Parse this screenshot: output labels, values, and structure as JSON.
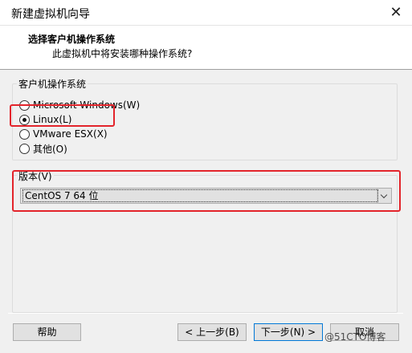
{
  "window": {
    "title": "新建虚拟机向导"
  },
  "header": {
    "title": "选择客户机操作系统",
    "subtitle": "此虚拟机中将安装哪种操作系统?"
  },
  "guest_os": {
    "label": "客户机操作系统",
    "options": [
      {
        "label": "Microsoft Windows(W)",
        "checked": false
      },
      {
        "label": "Linux(L)",
        "checked": true
      },
      {
        "label": "VMware ESX(X)",
        "checked": false
      },
      {
        "label": "其他(O)",
        "checked": false
      }
    ]
  },
  "version": {
    "label": "版本(V)",
    "selected": "CentOS 7 64 位"
  },
  "buttons": {
    "help": "帮助",
    "back": "< 上一步(B)",
    "next": "下一步(N) >",
    "cancel": "取消"
  },
  "watermark": "@51CTO博客",
  "colors": {
    "highlight": "#e3242b",
    "focus_border": "#0078d7"
  }
}
